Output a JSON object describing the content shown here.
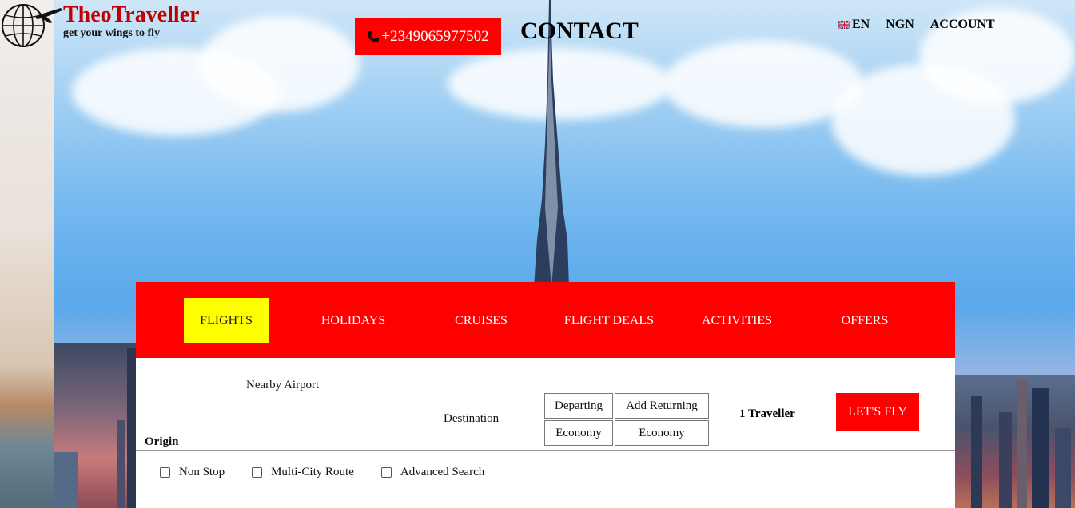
{
  "brand": {
    "name": "TheoTraveller",
    "tagline": "get your wings to fly"
  },
  "header": {
    "phone": "+2349065977502",
    "contact_label": "CONTACT",
    "language": "EN",
    "currency": "NGN",
    "account": "ACCOUNT"
  },
  "tabs": [
    {
      "label": "FLIGHTS",
      "active": true
    },
    {
      "label": "HOLIDAYS"
    },
    {
      "label": "CRUISES"
    },
    {
      "label": "FLIGHT DEALS"
    },
    {
      "label": "ACTIVITIES"
    },
    {
      "label": "OFFERS"
    }
  ],
  "search": {
    "nearby_airport": "Nearby Airport",
    "origin": "Origin",
    "destination": "Destination",
    "departing": "Departing",
    "add_returning": "Add Returning",
    "cabin_outbound": "Economy",
    "cabin_return": "Economy",
    "travellers": "1 Traveller",
    "submit": "LET'S FLY"
  },
  "options": [
    {
      "label": "Non Stop",
      "checked": false
    },
    {
      "label": "Multi-City Route",
      "checked": false
    },
    {
      "label": "Advanced Search",
      "checked": false
    }
  ],
  "colors": {
    "brand_red": "#ff0000",
    "logo_red": "#c00000",
    "active_tab": "#ffff00"
  }
}
